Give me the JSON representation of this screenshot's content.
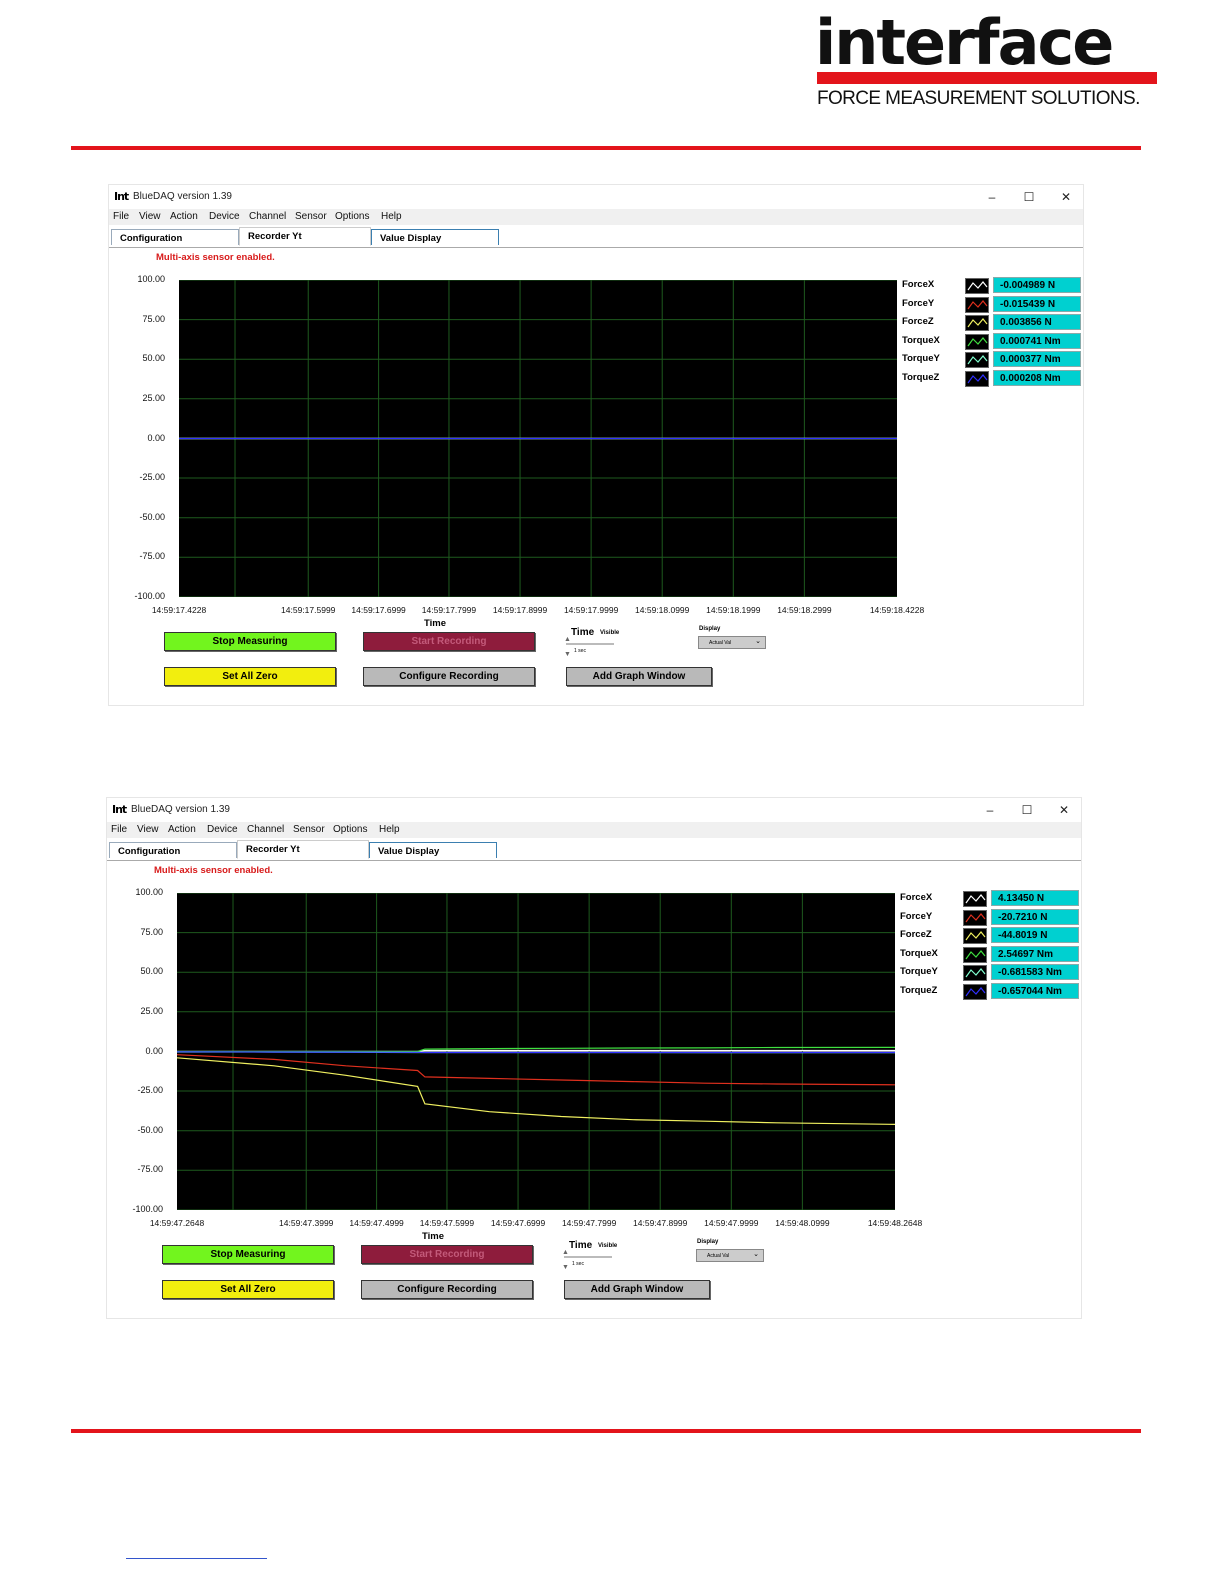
{
  "header": {
    "logo_text": "interface",
    "logo_tagline": "FORCE MEASUREMENT SOLUTIONS."
  },
  "colors": {
    "brand_red": "#e3141b",
    "cyan_value": "#00d0d0"
  },
  "windows": [
    {
      "title": "BlueDAQ version 1.39",
      "icon_text": "Int",
      "menu": [
        "File",
        "View",
        "Action",
        "Device",
        "Channel",
        "Sensor",
        "Options",
        "Help"
      ],
      "window_controls": [
        "–",
        "☐",
        "✕"
      ],
      "tabs": [
        "Configuration",
        "Recorder Yt",
        "Value Display"
      ],
      "status": "Multi-axis sensor enabled.",
      "y_ticks": [
        "100.00",
        "75.00",
        "50.00",
        "25.00",
        "0.00",
        "-25.00",
        "-50.00",
        "-75.00",
        "-100.00"
      ],
      "x_ticks": [
        "14:59:17.4228",
        "14:59:17.5999",
        "14:59:17.6999",
        "14:59:17.7999",
        "14:59:17.8999",
        "14:59:17.9999",
        "14:59:18.0999",
        "14:59:18.1999",
        "14:59:18.2999",
        "14:59:18.4228"
      ],
      "x_title": "Time",
      "legend": [
        {
          "name": "ForceX",
          "value": "-0.004989 N",
          "color": "#ffffff"
        },
        {
          "name": "ForceY",
          "value": "-0.015439 N",
          "color": "#e0301e"
        },
        {
          "name": "ForceZ",
          "value": "0.003856 N",
          "color": "#f0f060"
        },
        {
          "name": "TorqueX",
          "value": "0.000741 Nm",
          "color": "#40e040"
        },
        {
          "name": "TorqueY",
          "value": "0.000377 Nm",
          "color": "#80ffd0"
        },
        {
          "name": "TorqueZ",
          "value": "0.000208 Nm",
          "color": "#3030ff"
        }
      ],
      "buttons": {
        "stop": "Stop Measuring",
        "start": "Start Recording",
        "zero": "Set All Zero",
        "configure": "Configure Recording",
        "add_graph": "Add Graph Window"
      },
      "time_label": "Time",
      "time_visible_label": "Visible",
      "time_value": "1 sec",
      "display_label": "Display",
      "display_value": "Actual Val"
    },
    {
      "title": "BlueDAQ version 1.39",
      "icon_text": "Int",
      "menu": [
        "File",
        "View",
        "Action",
        "Device",
        "Channel",
        "Sensor",
        "Options",
        "Help"
      ],
      "window_controls": [
        "–",
        "☐",
        "✕"
      ],
      "tabs": [
        "Configuration",
        "Recorder Yt",
        "Value Display"
      ],
      "status": "Multi-axis sensor enabled.",
      "y_ticks": [
        "100.00",
        "75.00",
        "50.00",
        "25.00",
        "0.00",
        "-25.00",
        "-50.00",
        "-75.00",
        "-100.00"
      ],
      "x_ticks": [
        "14:59:47.2648",
        "14:59:47.3999",
        "14:59:47.4999",
        "14:59:47.5999",
        "14:59:47.6999",
        "14:59:47.7999",
        "14:59:47.8999",
        "14:59:47.9999",
        "14:59:48.0999",
        "14:59:48.2648"
      ],
      "x_title": "Time",
      "legend": [
        {
          "name": "ForceX",
          "value": "4.13450 N",
          "color": "#ffffff"
        },
        {
          "name": "ForceY",
          "value": "-20.7210 N",
          "color": "#e0301e"
        },
        {
          "name": "ForceZ",
          "value": "-44.8019 N",
          "color": "#f0f060"
        },
        {
          "name": "TorqueX",
          "value": "2.54697 Nm",
          "color": "#40e040"
        },
        {
          "name": "TorqueY",
          "value": "-0.681583 Nm",
          "color": "#80ffd0"
        },
        {
          "name": "TorqueZ",
          "value": "-0.657044 Nm",
          "color": "#3030ff"
        }
      ],
      "buttons": {
        "stop": "Stop Measuring",
        "start": "Start Recording",
        "zero": "Set All Zero",
        "configure": "Configure Recording",
        "add_graph": "Add Graph Window"
      },
      "time_label": "Time",
      "time_visible_label": "Visible",
      "time_value": "1 sec",
      "display_label": "Display",
      "display_value": "Actual Val"
    }
  ],
  "chart_data": [
    {
      "type": "line",
      "ylim": [
        -100,
        100
      ],
      "xlabel": "Time",
      "x": [
        "14:59:17.4228",
        "14:59:18.4228"
      ],
      "series": [
        {
          "name": "ForceX",
          "values": [
            0,
            0
          ]
        },
        {
          "name": "ForceY",
          "values": [
            0,
            0
          ]
        },
        {
          "name": "ForceZ",
          "values": [
            0,
            0
          ]
        },
        {
          "name": "TorqueX",
          "values": [
            0,
            0
          ]
        },
        {
          "name": "TorqueY",
          "values": [
            0,
            0
          ]
        },
        {
          "name": "TorqueZ",
          "values": [
            0,
            0
          ]
        }
      ]
    },
    {
      "type": "line",
      "ylim": [
        -100,
        100
      ],
      "xlabel": "Time",
      "x": [
        "14:59:47.2648",
        "14:59:47.3999",
        "14:59:47.4999",
        "14:59:47.5999",
        "14:59:47.6100",
        "14:59:47.6999",
        "14:59:47.7999",
        "14:59:47.8999",
        "14:59:47.9999",
        "14:59:48.0999",
        "14:59:48.2648"
      ],
      "series": [
        {
          "name": "ForceX",
          "values": [
            0,
            0,
            0,
            0,
            0.6,
            0.6,
            0.6,
            0.6,
            0.6,
            0.6,
            0.6
          ]
        },
        {
          "name": "ForceY",
          "values": [
            -2,
            -5,
            -9,
            -12,
            -16,
            -17,
            -18,
            -19,
            -20,
            -20.5,
            -21
          ]
        },
        {
          "name": "ForceZ",
          "values": [
            -4,
            -9,
            -15,
            -22,
            -33,
            -38,
            -41,
            -43,
            -44,
            -45,
            -46
          ]
        },
        {
          "name": "TorqueX",
          "values": [
            0,
            0,
            0,
            0,
            1.5,
            1.8,
            2,
            2.2,
            2.3,
            2.5,
            2.6
          ]
        },
        {
          "name": "TorqueY",
          "values": [
            -0.3,
            -0.4,
            -0.5,
            -0.6,
            -0.6,
            -0.6,
            -0.6,
            -0.6,
            -0.7,
            -0.7,
            -0.7
          ]
        },
        {
          "name": "TorqueZ",
          "values": [
            -0.2,
            -0.3,
            -0.4,
            -0.5,
            -0.6,
            -0.6,
            -0.6,
            -0.6,
            -0.6,
            -0.6,
            -0.6
          ]
        }
      ]
    }
  ]
}
